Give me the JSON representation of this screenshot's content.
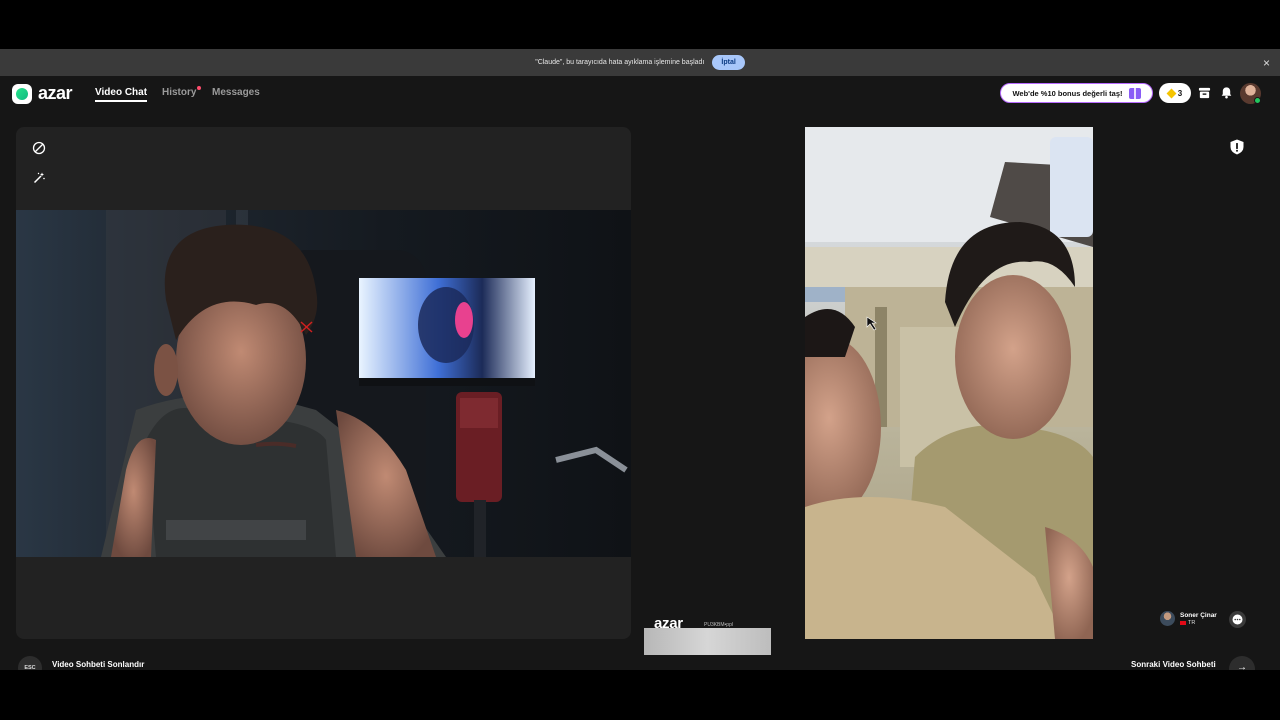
{
  "debug_banner": {
    "message": "\"Claude\", bu tarayıcıda hata ayıklama işlemine başladı",
    "cancel_label": "İptal",
    "close_glyph": "×"
  },
  "brand": {
    "logo_text": "azar",
    "accent_color": "#22c55e"
  },
  "nav": {
    "tabs": [
      {
        "label": "Video Chat",
        "active": true
      },
      {
        "label": "History",
        "active": false,
        "has_dot": true
      },
      {
        "label": "Messages",
        "active": false
      }
    ]
  },
  "header": {
    "promo_label": "Web'de %10 bonus değerli taş!",
    "gem_count": "3",
    "icons": [
      "gift-icon",
      "gem-icon",
      "store-icon",
      "bell-icon",
      "profile-avatar"
    ]
  },
  "left_panel": {
    "tools": [
      "camera-off-icon",
      "magic-wand-icon"
    ]
  },
  "watermark": {
    "logo_text": "azar",
    "id_text": "PU3KBM•ppl"
  },
  "peer": {
    "name": "Soner Çinar",
    "country": "TR"
  },
  "footer": {
    "esc_label": "ESC",
    "end_label": "Video Sohbeti Sonlandır",
    "next_label": "Sonraki Video Sohbeti",
    "next_glyph": "→"
  }
}
